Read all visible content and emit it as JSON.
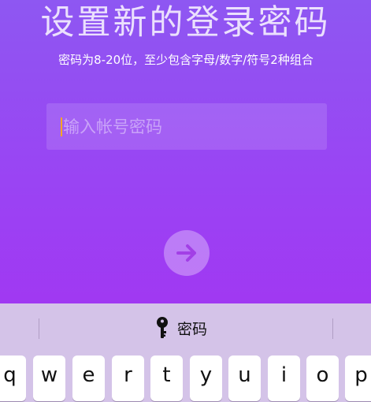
{
  "header": {
    "title": "设置新的登录密码",
    "subtitle": "密码为8-20位，至少包含字母/数字/符号2种组合"
  },
  "password_input": {
    "placeholder": "输入帐号密码",
    "value": ""
  },
  "next_button": {
    "icon": "arrow-right-icon"
  },
  "keyboard": {
    "suggestion": {
      "icon": "key-icon",
      "label": "密码"
    },
    "keys": [
      "q",
      "w",
      "e",
      "r",
      "t",
      "y",
      "u",
      "i",
      "o",
      "p"
    ]
  },
  "colors": {
    "background_top": "#8e57f2",
    "background_bottom": "#a52ff2",
    "cursor": "#f5a623",
    "button_arrow": "#a23fe6",
    "keyboard_background": "#d4c3e8"
  }
}
